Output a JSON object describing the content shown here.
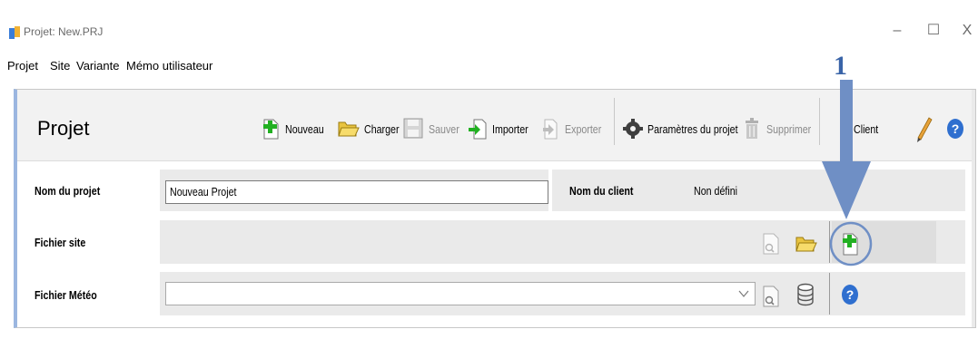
{
  "window": {
    "title": "Projet: New.PRJ",
    "controls": {
      "minimize": "–",
      "maximize": "☐",
      "close": "X"
    }
  },
  "menu": [
    "Projet",
    "Site",
    "Variante",
    "Mémo utilisateur"
  ],
  "panel": {
    "title": "Projet",
    "toolbar": {
      "new": "Nouveau",
      "load": "Charger",
      "save": "Sauver",
      "import": "Importer",
      "export": "Exporter",
      "params": "Paramètres du projet",
      "delete": "Supprimer",
      "client": "Client"
    }
  },
  "form": {
    "project_name_label": "Nom du projet",
    "project_name_value": "Nouveau Projet",
    "client_name_label": "Nom du client",
    "client_name_value": "Non défini",
    "site_file_label": "Fichier site",
    "meteo_file_label": "Fichier Météo",
    "meteo_file_value": ""
  },
  "annotation": {
    "number": "1"
  },
  "colors": {
    "arrow": "#6f8fc5",
    "annotation_text": "#3a64a8",
    "panel_accent": "#9bb6e0",
    "plus_green": "#22b022"
  }
}
